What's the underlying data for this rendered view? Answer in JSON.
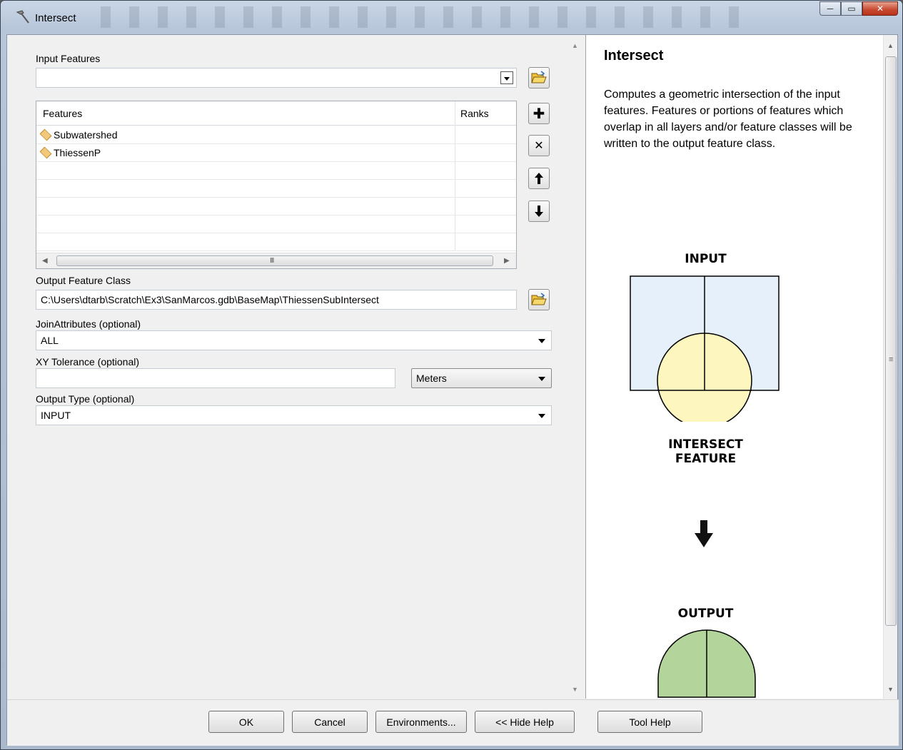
{
  "window": {
    "title": "Intersect",
    "controls": {
      "minimize": "─",
      "maximize": "▭",
      "close": "✕"
    }
  },
  "form": {
    "input_features_label": "Input Features",
    "input_features_value": "",
    "table": {
      "headers": [
        "Features",
        "Ranks"
      ],
      "rows": [
        {
          "feature": "Subwatershed",
          "rank": ""
        },
        {
          "feature": "ThiessenP",
          "rank": ""
        }
      ]
    },
    "add_symbol": "✚",
    "remove_symbol": "✕",
    "up_symbol": "🡅",
    "down_symbol": "🡇",
    "output_feature_class_label": "Output Feature Class",
    "output_feature_class_value": "C:\\Users\\dtarb\\Scratch\\Ex3\\SanMarcos.gdb\\BaseMap\\ThiessenSubIntersect",
    "join_attributes_label": "JoinAttributes (optional)",
    "join_attributes_value": "ALL",
    "xy_tolerance_label": "XY Tolerance (optional)",
    "xy_tolerance_value": "",
    "xy_units_value": "Meters",
    "output_type_label": "Output Type (optional)",
    "output_type_value": "INPUT",
    "scroll_grip": "III"
  },
  "help": {
    "title": "Intersect",
    "description": "Computes a geometric intersection of the input features. Features or portions of features which overlap in all layers and/or feature classes will be written to the output feature class.",
    "diagram": {
      "input_label": "INPUT",
      "intersect_label_line1": "INTERSECT",
      "intersect_label_line2": "FEATURE",
      "output_label": "OUTPUT"
    }
  },
  "buttons": {
    "ok": "OK",
    "cancel": "Cancel",
    "environments": "Environments...",
    "hide_help": "<< Hide Help",
    "tool_help": "Tool Help"
  },
  "colors": {
    "input_fill": "#e6f0fa",
    "circle_fill": "#fdf6bf",
    "output_fill": "#b3d49a",
    "folder": "#f3c23b"
  }
}
